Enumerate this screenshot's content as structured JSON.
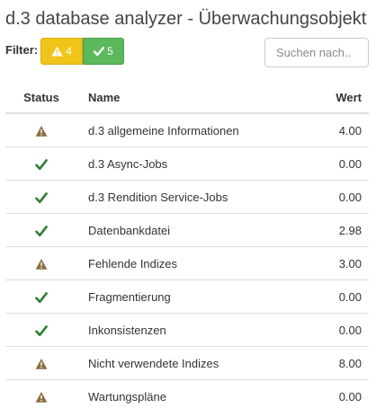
{
  "title": "d.3 database analyzer - Überwachungsobjekt",
  "filter": {
    "label": "Filter:",
    "warning_count": "4",
    "ok_count": "5",
    "warning_color": "#f0c419",
    "ok_color": "#5bb85b"
  },
  "search": {
    "placeholder": "Suchen nach..",
    "value": ""
  },
  "table": {
    "headers": {
      "status": "Status",
      "name": "Name",
      "value": "Wert"
    },
    "rows": [
      {
        "status": "warning-icon",
        "name": "d.3 allgemeine Informationen",
        "value": "4.00"
      },
      {
        "status": "check-icon",
        "name": "d.3 Async-Jobs",
        "value": "0.00"
      },
      {
        "status": "check-icon",
        "name": "d.3 Rendition Service-Jobs",
        "value": "0.00"
      },
      {
        "status": "check-icon",
        "name": "Datenbankdatei",
        "value": "2.98"
      },
      {
        "status": "warning-icon",
        "name": "Fehlende Indizes",
        "value": "3.00"
      },
      {
        "status": "check-icon",
        "name": "Fragmentierung",
        "value": "0.00"
      },
      {
        "status": "check-icon",
        "name": "Inkonsistenzen",
        "value": "0.00"
      },
      {
        "status": "warning-icon",
        "name": "Nicht verwendete Indizes",
        "value": "8.00"
      },
      {
        "status": "warning-icon",
        "name": "Wartungspläne",
        "value": "0.00"
      }
    ]
  },
  "colors": {
    "warning_icon": "#8b6d3f",
    "check_icon": "#2e7d32"
  }
}
